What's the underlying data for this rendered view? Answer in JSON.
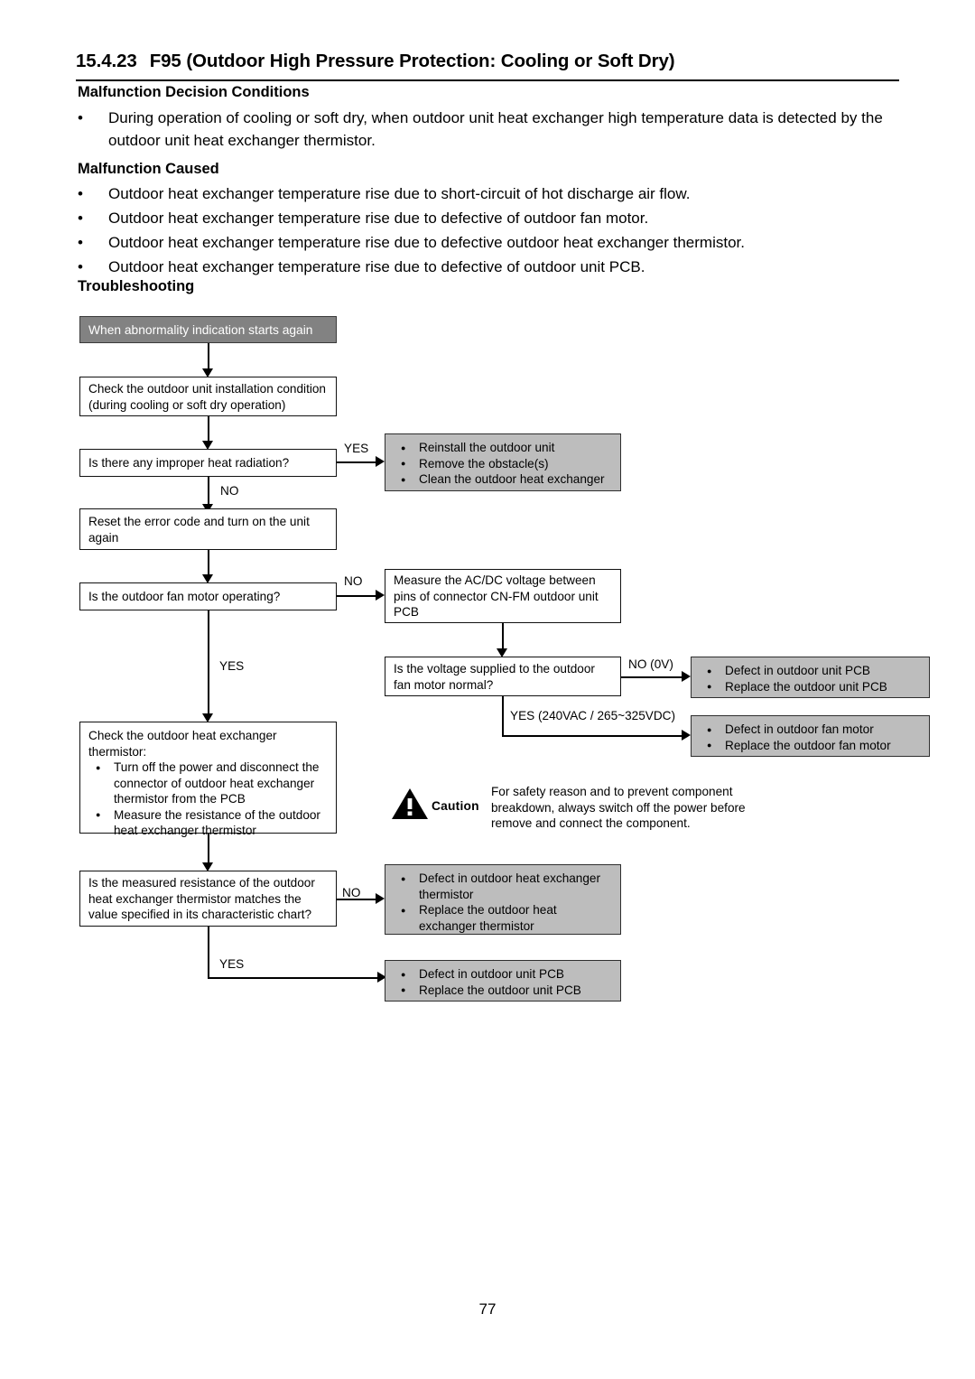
{
  "document": {
    "section_number": "15.4.23",
    "section_title": "F95 (Outdoor High Pressure Protection: Cooling or Soft Dry)",
    "page_number": "77"
  },
  "sections": {
    "decision_conditions": {
      "heading": "Malfunction Decision Conditions",
      "bullets": [
        "During operation of cooling or soft dry, when outdoor unit heat exchanger high temperature data is detected by the outdoor unit heat exchanger thermistor."
      ]
    },
    "malfunction_caused": {
      "heading": "Malfunction Caused",
      "bullets": [
        "Outdoor heat exchanger temperature rise due to short-circuit of hot discharge air flow.",
        "Outdoor heat exchanger temperature rise due to defective of outdoor fan motor.",
        "Outdoor heat exchanger temperature rise due to defective outdoor heat exchanger thermistor.",
        "Outdoor heat exchanger temperature rise due to defective of outdoor unit PCB."
      ]
    },
    "troubleshooting": {
      "heading": "Troubleshooting"
    }
  },
  "flowchart": {
    "start_box": "When abnormality indication starts again",
    "check_installation": "Check the outdoor unit installation condition (during cooling or soft dry operation)",
    "q_heat_radiation": "Is there any improper heat radiation?",
    "heat_radiation_yes_actions": [
      "Reinstall the outdoor unit",
      "Remove the obstacle(s)",
      "Clean the outdoor heat exchanger"
    ],
    "reset_error": "Reset the error code and turn on the unit again",
    "q_fan_motor": "Is the outdoor fan motor operating?",
    "measure_voltage": "Measure the AC/DC voltage between pins of connector CN-FM outdoor unit PCB",
    "q_voltage_normal": "Is the voltage supplied to the outdoor fan motor normal?",
    "voltage_no_actions": [
      "Defect in outdoor unit PCB",
      "Replace the outdoor unit PCB"
    ],
    "voltage_yes_actions": [
      "Defect in outdoor fan motor",
      "Replace the outdoor fan motor"
    ],
    "check_thermistor_title": "Check the outdoor heat exchanger thermistor:",
    "check_thermistor_steps": [
      "Turn off the power and disconnect the connector of outdoor heat exchanger thermistor from the PCB",
      "Measure the resistance of the outdoor heat exchanger thermistor"
    ],
    "q_resistance": "Is the measured resistance of the outdoor heat exchanger thermistor matches the value specified in its characteristic chart?",
    "resistance_no_actions": [
      "Defect in outdoor heat exchanger thermistor",
      "Replace the outdoor heat exchanger thermistor"
    ],
    "resistance_yes_actions": [
      "Defect in outdoor unit PCB",
      "Replace the outdoor unit PCB"
    ],
    "labels": {
      "yes": "YES",
      "no": "NO",
      "no_0v": "NO (0V)",
      "yes_voltage": "YES (240VAC / 265~325VDC)"
    }
  },
  "caution": {
    "word": "Caution",
    "text": "For safety reason and to prevent component breakdown, always switch off the power before remove and connect the component."
  },
  "colors": {
    "start_box_fill": "#828282",
    "action_box_fill": "#bdbdbd",
    "line": "#000000",
    "page_background": "#ffffff"
  }
}
